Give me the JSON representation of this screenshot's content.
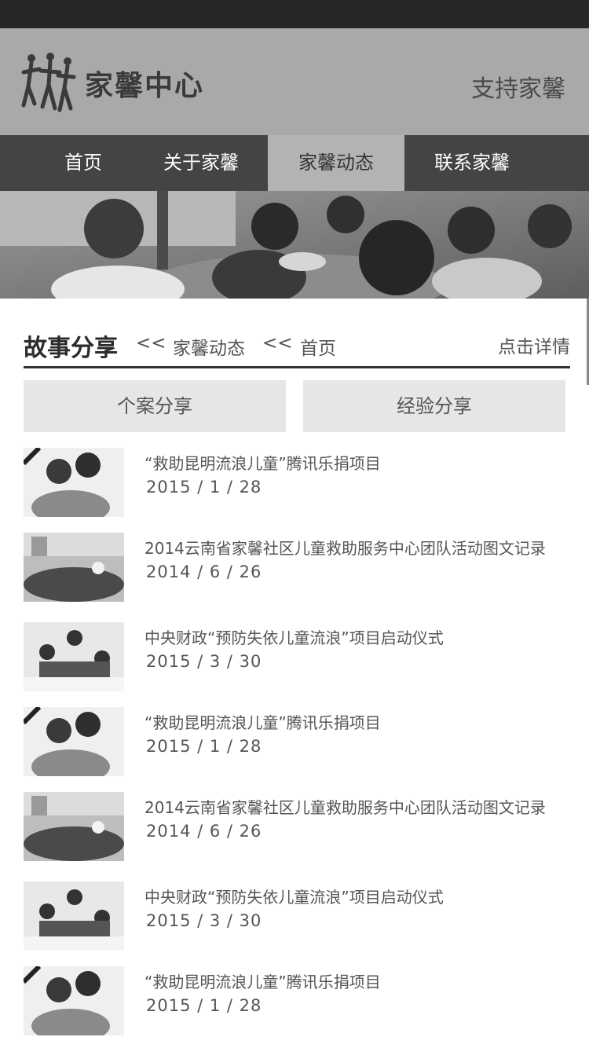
{
  "header": {
    "logo_text": "家馨中心",
    "support_label": "支持家馨"
  },
  "nav": {
    "items": [
      "首页",
      "关于家馨",
      "家馨动态",
      "联系家馨"
    ],
    "active_index": 2
  },
  "breadcrumb": {
    "title": "故事分享",
    "separator": "<<",
    "crumb_1": "家馨动态",
    "crumb_2": "首页",
    "detail_label": "点击详情"
  },
  "tabs": {
    "case_label": "个案分享",
    "experience_label": "经验分享"
  },
  "list": [
    {
      "title": "“救助昆明流浪儿童”腾讯乐捐项目",
      "date": "2015 / 1 / 28"
    },
    {
      "title": "2014云南省家馨社区儿童救助服务中心团队活动图文记录",
      "date": "2014 / 6 / 26"
    },
    {
      "title": "中央财政“预防失依儿童流浪”项目启动仪式",
      "date": "2015 / 3 / 30"
    },
    {
      "title": "“救助昆明流浪儿童”腾讯乐捐项目",
      "date": "2015 / 1 / 28"
    },
    {
      "title": "2014云南省家馨社区儿童救助服务中心团队活动图文记录",
      "date": "2014 / 6 / 26"
    },
    {
      "title": "中央财政“预防失依儿童流浪”项目启动仪式",
      "date": "2015 / 3 / 30"
    },
    {
      "title": "“救助昆明流浪儿童”腾讯乐捐项目",
      "date": "2015 / 1 / 28"
    }
  ]
}
